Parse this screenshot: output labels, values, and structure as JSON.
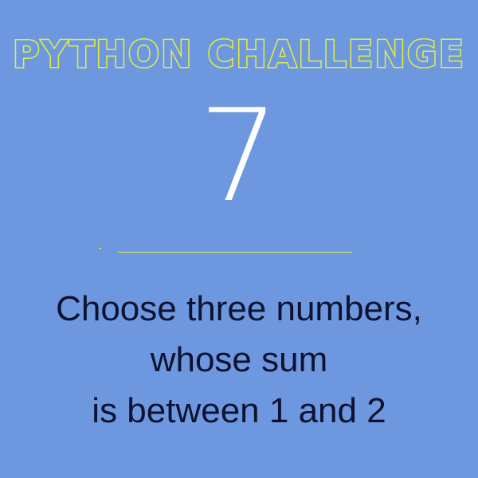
{
  "title": "PYTHON CHALLENGE",
  "challenge_number": "7",
  "question": {
    "lines": [
      "Choose three numbers,",
      "whose sum",
      "is between 1 and 2"
    ]
  },
  "colors": {
    "background": "#6d98e0",
    "title": "#e6ee3a",
    "number": "#ffffff",
    "text": "#0d1230",
    "divider": "#e6ee3a"
  }
}
